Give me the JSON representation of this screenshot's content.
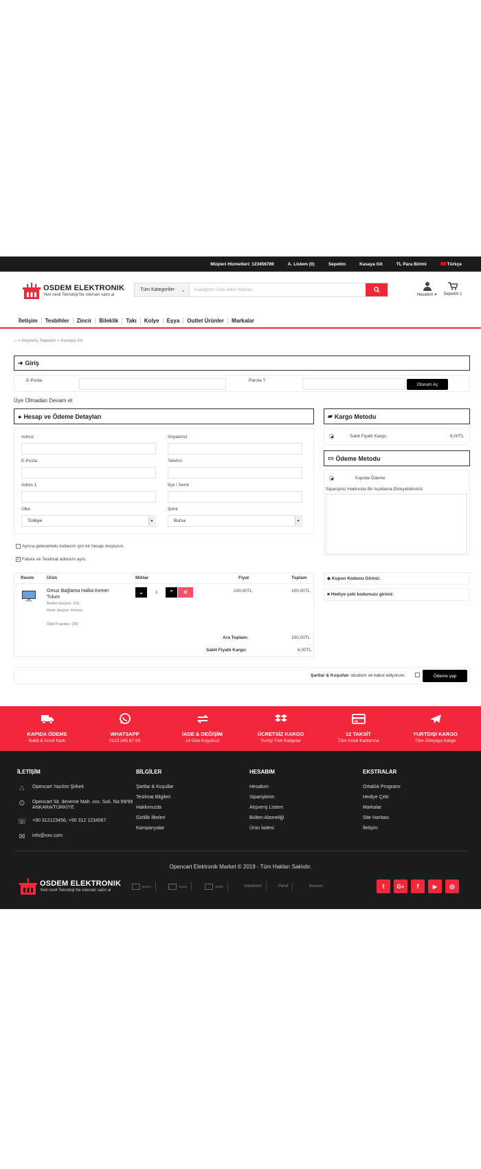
{
  "topbar": {
    "customer_service": "Müşteri Hizmetleri: 123456789",
    "wishlist": "A. Listem (0)",
    "cart": "Sepetim",
    "checkout": "Kasaya Git",
    "currency": "TL Para Birimi",
    "language": "Türkçe"
  },
  "header": {
    "logo_title": "OSDEM ELEKTRONIK",
    "logo_sub": "Yeni nesil Teknoloji Ne istersen satın al",
    "category_select": "Tüm Kategoriler",
    "search_placeholder": "Aradığınız Ürün Adını Yazınız..",
    "account": "Hesabım",
    "cart": "Sepetim 1"
  },
  "nav": [
    "İletişim",
    "Tesbihler",
    "Zincir",
    "Bileklik",
    "Takı",
    "Kolye",
    "Eşya",
    "Outlet Ürünler",
    "Markalar"
  ],
  "breadcrumb": "> Alışveriş Sepetim > Kasaya Git",
  "login": {
    "title": "Giriş",
    "email_label": "E-Posta",
    "password_label": "Parola",
    "login_button": "Oturum Aç",
    "guest": "Üye Olmadan Devam et"
  },
  "account_details": {
    "title": "Hesap ve Ödeme Detayları",
    "firstname": "Adınız",
    "lastname": "Soyadınız",
    "email": "E-Posta",
    "phone": "Telefon",
    "address": "Adres 1",
    "district": "İlçe / Semt",
    "country_label": "Ülke",
    "country_value": "Türkiye",
    "city_label": "Şehir",
    "city_value": "Bursa",
    "create_account": "Ayrıca gelecekteki kullanım için bir hesap oluşturun.",
    "same_address": "Fatura ve Teslimat adresim aynı."
  },
  "shipping": {
    "title": "Kargo Metodu",
    "option": "Sabit Fiyatlı Kargo",
    "price": "6,00TL"
  },
  "payment": {
    "title": "Ödeme Metodu",
    "option": "Kapıda Ödeme",
    "comment_label": "Siparişiniz Hakkında Bir Açıklama Ekleyebilirsiniz"
  },
  "cart_table": {
    "headers": {
      "image": "Resim",
      "product": "Ürün",
      "qty": "Miktar",
      "price": "Fiyat",
      "total": "Toplam"
    },
    "item": {
      "name": "Omuz Bağlama Halka Kemer Tulum",
      "option1": "Beden Seçiniz: XXL",
      "option2": "Renk Seçiniz: Kırmızı",
      "points": "Ödül Puanları: 300",
      "qty": "1",
      "price": "100,00TL",
      "total": "100,00TL"
    },
    "subtotal_label": "Ara Toplam:",
    "subtotal": "100,00TL",
    "shipping_label": "Sabit Fiyatlı Kargo:",
    "shipping": "6,00TL"
  },
  "coupon": "Kupon Kodunu Giriniz:",
  "giftcard": "Hediye çeki kodunuzu giriniz:",
  "terms": {
    "link": "Şartlar & Koşullar",
    "text": "ı okudum ve kabul ediyorum.",
    "pay_button": "Ödeme yap"
  },
  "features": [
    {
      "icon": "truck-icon",
      "title": "KAPIDA ÖDEME",
      "sub": "Nakit & Kredi Kartı"
    },
    {
      "icon": "whatsapp-icon",
      "title": "WHATSAPP",
      "sub": "0123 345 67 89"
    },
    {
      "icon": "exchange-icon",
      "title": "İADE & DEĞİŞİM",
      "sub": "14 Gün Koşulsuz"
    },
    {
      "icon": "dropbox-icon",
      "title": "ÜCRETSİZ KARGO",
      "sub": "Yurtiçi Tüm Kargolar"
    },
    {
      "icon": "credit-card-icon",
      "title": "12 TAKSİT",
      "sub": "Tüm Kredi Kartlarına"
    },
    {
      "icon": "plane-icon",
      "title": "YURTDIŞI KARGO",
      "sub": "Tüm Dünyaya Kargo"
    }
  ],
  "footer": {
    "contact_title": "İLETİŞİM",
    "company": "Opencart Yazılım Şirketi",
    "address": "Opencart Sit. deneme Mah. xxx. Sok. No:99/99 ANKARA/TÜRKİYE",
    "phone": "+90 312123456, +90 312 1234567",
    "email": "info@xxx.com",
    "info_title": "BİLGİLER",
    "info_links": [
      "Şartlar & Koşullar",
      "Teslimat Bilgileri",
      "Hakkımızda",
      "Gizlilik İlkeleri",
      "Kampanyalar"
    ],
    "account_title": "HESABIM",
    "account_links": [
      "Hesabım",
      "Siparişlerim",
      "Alışveriş Listem",
      "Bülten Aboneliği",
      "Ürün İadesi"
    ],
    "extras_title": "EKSTRALAR",
    "extras_links": [
      "Ortaklık Programı",
      "Hediye Çeki",
      "Markalar",
      "Site Haritası",
      "İletişim"
    ],
    "copyright": "Opencart Elektronik Market © 2019 - Tüm Hakları Saklıdır.",
    "banks": [
      "Bonus",
      "Axess",
      "World",
      "maximum",
      "Paraf",
      "Bankkart"
    ]
  },
  "colors": {
    "accent": "#f2273a",
    "dark": "#1b1b1b"
  }
}
